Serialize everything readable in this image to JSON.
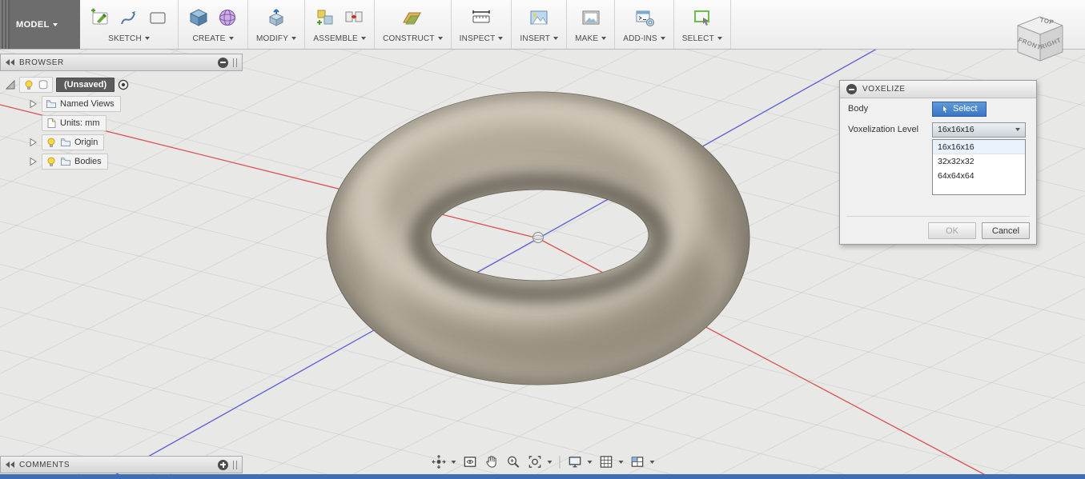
{
  "colors": {
    "accent_blue": "#3a76c4",
    "axis_red": "#d95252",
    "axis_blue": "#5c5cd8",
    "selection_green": "#6cc04a"
  },
  "titlebar": {
    "model_label": "MODEL"
  },
  "toolbar": {
    "groups": [
      {
        "label": "SKETCH"
      },
      {
        "label": "CREATE"
      },
      {
        "label": "MODIFY"
      },
      {
        "label": "ASSEMBLE"
      },
      {
        "label": "CONSTRUCT"
      },
      {
        "label": "INSPECT"
      },
      {
        "label": "INSERT"
      },
      {
        "label": "MAKE"
      },
      {
        "label": "ADD-INS"
      },
      {
        "label": "SELECT"
      }
    ]
  },
  "browser": {
    "title": "BROWSER",
    "root": {
      "label": "(Unsaved)"
    },
    "items": [
      {
        "label": "Named Views"
      },
      {
        "label": "Units: mm"
      },
      {
        "label": "Origin"
      },
      {
        "label": "Bodies"
      }
    ]
  },
  "voxelize_dialog": {
    "title": "VOXELIZE",
    "rows": {
      "body_label": "Body",
      "select_button": "Select",
      "level_label": "Voxelization Level",
      "level_value": "16x16x16"
    },
    "options": [
      {
        "label": "16x16x16"
      },
      {
        "label": "32x32x32"
      },
      {
        "label": "64x64x64"
      }
    ],
    "ok_button": "OK",
    "cancel_button": "Cancel"
  },
  "comments_panel": {
    "title": "COMMENTS"
  },
  "viewcube": {
    "top": "TOP",
    "front": "FRONT",
    "right": "RIGHT"
  }
}
